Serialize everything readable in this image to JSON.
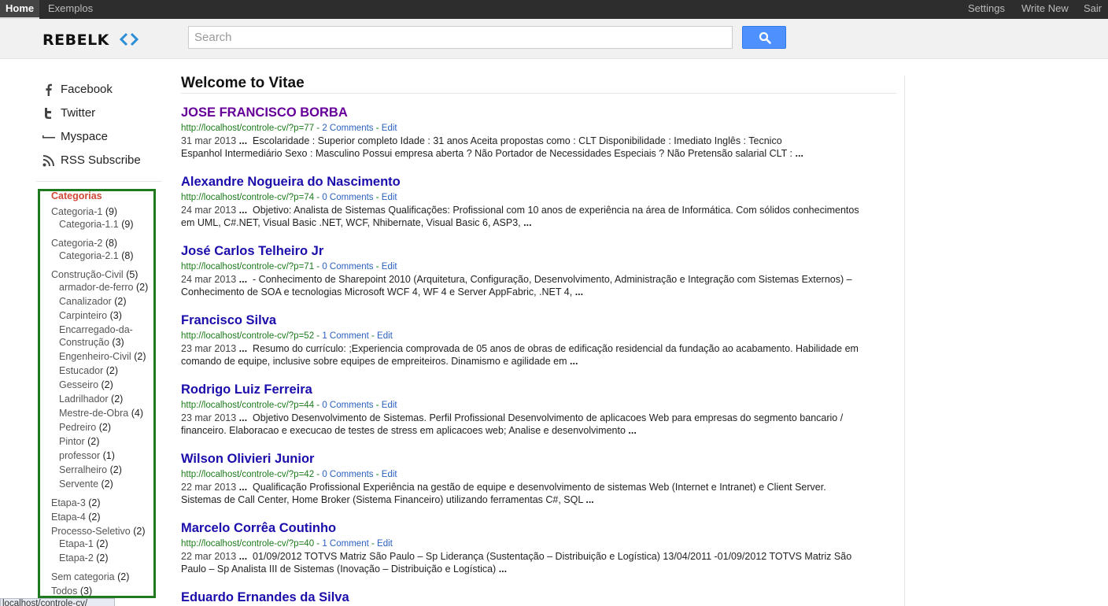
{
  "topbar": {
    "home": "Home",
    "examples": "Exemplos",
    "settings": "Settings",
    "write_new": "Write New",
    "sair": "Sair"
  },
  "header": {
    "logo_text": "REBELK",
    "search_placeholder": "Search"
  },
  "social": [
    {
      "label": "Facebook",
      "icon": "facebook-icon"
    },
    {
      "label": "Twitter",
      "icon": "twitter-icon"
    },
    {
      "label": "Myspace",
      "icon": "myspace-icon"
    },
    {
      "label": "RSS Subscribe",
      "icon": "rss-icon"
    }
  ],
  "categories": {
    "heading": "Categorias",
    "items": [
      {
        "name": "Categoria-1",
        "count": "(9)"
      },
      {
        "name": "Categoria-1.1",
        "count": "(9)"
      },
      {
        "name": "Categoria-2",
        "count": "(8)"
      },
      {
        "name": "Categoria-2.1",
        "count": "(8)"
      },
      {
        "name": "Construção-Civil",
        "count": "(5)"
      },
      {
        "name": "armador-de-ferro",
        "count": "(2)"
      },
      {
        "name": "Canalizador",
        "count": "(2)"
      },
      {
        "name": "Carpinteiro",
        "count": "(3)"
      },
      {
        "name": "Encarregado-da-",
        "count": ""
      },
      {
        "name": "Construção",
        "count": "(3)"
      },
      {
        "name": "Engenheiro-Civil",
        "count": "(2)"
      },
      {
        "name": "Estucador",
        "count": "(2)"
      },
      {
        "name": "Gesseiro",
        "count": "(2)"
      },
      {
        "name": "Ladrilhador",
        "count": "(2)"
      },
      {
        "name": "Mestre-de-Obra",
        "count": "(4)"
      },
      {
        "name": "Pedreiro",
        "count": "(2)"
      },
      {
        "name": "Pintor",
        "count": "(2)"
      },
      {
        "name": "professor",
        "count": "(1)"
      },
      {
        "name": "Serralheiro",
        "count": "(2)"
      },
      {
        "name": "Servente",
        "count": "(2)"
      },
      {
        "name": "Etapa-3",
        "count": "(2)"
      },
      {
        "name": "Etapa-4",
        "count": "(2)"
      },
      {
        "name": "Processo-Seletivo",
        "count": "(2)"
      },
      {
        "name": "Etapa-1",
        "count": "(2)"
      },
      {
        "name": "Etapa-2",
        "count": "(2)"
      },
      {
        "name": "Sem categoria",
        "count": "(2)"
      },
      {
        "name": "Todos",
        "count": "(3)"
      }
    ]
  },
  "main": {
    "title": "Welcome to Vitae",
    "results": [
      {
        "title": "JOSE FRANCISCO BORBA",
        "url": "http://localhost/controle-cv/?p=77",
        "comments": "2 Comments",
        "edit": "Edit",
        "date": "31 mar 2013",
        "line1": "Escolaridade : Superior completo Idade : 31 anos Aceita propostas como : CLT Disponibilidade : Imediato  Inglês : Tecnico",
        "line2": "Espanhol Intermediário Sexo : Masculino Possui empresa aberta ? Não Portador de Necessidades Especiais ? Não Pretensão salarial CLT :"
      },
      {
        "title": "Alexandre Nogueira do Nascimento",
        "url": "http://localhost/controle-cv/?p=74",
        "comments": "0 Comments",
        "edit": "Edit",
        "date": "24 mar 2013",
        "line1": "Objetivo: Analista de Sistemas Qualificações: Profissional com 10 anos de experiência na área de Informática. Com sólidos conhecimentos",
        "line2": "em UML, C#.NET, Visual Basic .NET, WCF, Nhibernate, Visual Basic 6, ASP3,"
      },
      {
        "title": "José Carlos Telheiro Jr",
        "url": "http://localhost/controle-cv/?p=71",
        "comments": "0 Comments",
        "edit": "Edit",
        "date": "24 mar 2013",
        "line1": "- Conhecimento de Sharepoint 2010 (Arquitetura, Configuração, Desenvolvimento, Administração e Integração com Sistemas Externos) –",
        "line2": "Conhecimento de SOA e tecnologias Microsoft WCF 4, WF 4 e Server AppFabric, .NET 4,"
      },
      {
        "title": "Francisco Silva",
        "url": "http://localhost/controle-cv/?p=52",
        "comments": "1 Comment",
        "edit": "Edit",
        "date": "23 mar 2013",
        "line1": "Resumo do currículo: ;Experiencia comprovada de 05 anos de obras de edificação residencial da fundação ao acabamento. Habilidade em",
        "line2": "comando de equipe, inclusive sobre equipes de empreiteiros. Dinamismo e agilidade em"
      },
      {
        "title": "Rodrigo Luiz Ferreira",
        "url": "http://localhost/controle-cv/?p=44",
        "comments": "0 Comments",
        "edit": "Edit",
        "date": "23 mar 2013",
        "line1": "Objetivo Desenvolvimento de Sistemas. Perfil Profissional Desenvolvimento de aplicacoes Web para empresas do segmento bancario /",
        "line2": "financeiro. Elaboracao e execucao de testes de stress em aplicacoes web; Analise e desenvolvimento"
      },
      {
        "title": "Wilson Olivieri Junior",
        "url": "http://localhost/controle-cv/?p=42",
        "comments": "0 Comments",
        "edit": "Edit",
        "date": "22 mar 2013",
        "line1": "Qualificação Profissional Experiência na gestão de equipe e desenvolvimento de sistemas Web (Internet e Intranet) e Client Server.",
        "line2": "Sistemas de Call Center, Home Broker (Sistema Financeiro) utilizando ferramentas C#, SQL"
      },
      {
        "title": "Marcelo Corrêa Coutinho",
        "url": "http://localhost/controle-cv/?p=40",
        "comments": "1 Comment",
        "edit": "Edit",
        "date": "22 mar 2013",
        "line1": "01/09/2012 TOTVS Matriz São Paulo – Sp Liderança (Sustentação – Distribuição e Logística) 13/04/2011 -01/09/2012 TOTVS Matriz São",
        "line2": "Paulo – Sp Analista III de Sistemas (Inovação – Distribuição e Logística)"
      },
      {
        "title": "Eduardo Ernandes da Silva"
      }
    ]
  },
  "status_bar": "localhost/controle-cv/",
  "colors": {
    "topbar": "#2d2d2d",
    "link": "#1a0dab",
    "visited": "#660099",
    "url_green": "#1c7a1c",
    "search_blue": "#4d90fe",
    "category_box": "#1f7a1f",
    "category_heading": "#d14836"
  }
}
